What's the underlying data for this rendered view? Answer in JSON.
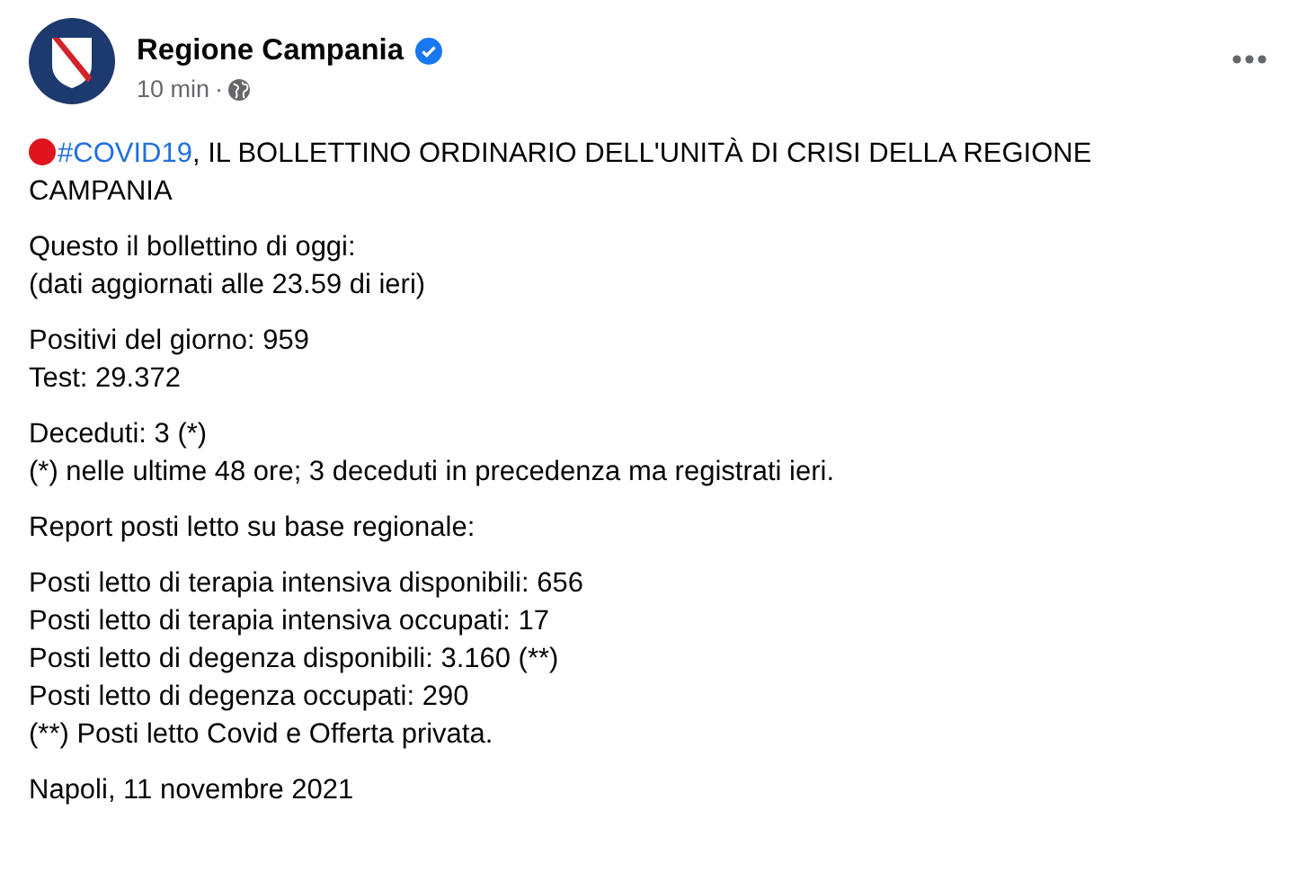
{
  "post": {
    "author": "Regione Campania",
    "verified": true,
    "time": "10 min",
    "separator": "·",
    "headline": {
      "hashtag": "#COVID19",
      "lines": [
        ", IL BOLLETTINO ORDINARIO DELL'UNITÀ DI CRISI DELLA REGIONE",
        "CAMPANIA"
      ]
    },
    "paragraphs": [
      [
        "Questo il bollettino di oggi:",
        "(dati aggiornati alle 23.59 di ieri)"
      ],
      [
        "Positivi del giorno: 959",
        "Test: 29.372"
      ],
      [
        "Deceduti: 3 (*)",
        "(*) nelle ultime 48 ore; 3 deceduti in precedenza ma registrati ieri."
      ],
      [
        "Report posti letto su base regionale:"
      ],
      [
        "Posti letto di terapia intensiva disponibili: 656",
        "Posti letto di terapia intensiva occupati: 17",
        "Posti letto di degenza disponibili: 3.160 (**)",
        "Posti letto di degenza occupati: 290",
        "(**) Posti letto Covid e Offerta privata."
      ],
      [
        "Napoli, 11 novembre 2021"
      ]
    ]
  }
}
